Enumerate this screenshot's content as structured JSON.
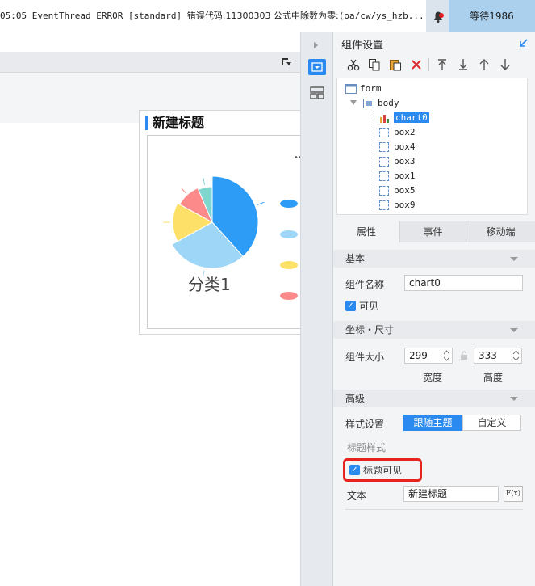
{
  "status": {
    "message_prefix": "05:05 EventThread ERROR [standard] ",
    "message_cjk": "错误代码:11300303 公式中除数为零:",
    "message_suffix": "(oa/cw/ys_hzb...",
    "user": "等待1986"
  },
  "chart_panel": {
    "title": "新建标题",
    "more_label": "•••",
    "category_label": "分类1",
    "legend_text": "..."
  },
  "chart_data": {
    "type": "pie",
    "title": "新建标题",
    "xlabel": "分类1",
    "slices": [
      {
        "value": 36,
        "color": "#2c9cf6"
      },
      {
        "value": 27,
        "color": "#9dd6f7"
      },
      {
        "value": 15,
        "color": "#fce067"
      },
      {
        "value": 10,
        "color": "#fc8a8a"
      },
      {
        "value": 6,
        "color": "#7fd6cf"
      }
    ],
    "legend_colors": [
      "#2c9cf6",
      "#9dd6f7",
      "#fce067",
      "#fc8a8a"
    ]
  },
  "right_panel": {
    "header": "组件设置",
    "tree": {
      "form": "form",
      "body": "body",
      "items": [
        "chart0",
        "box2",
        "box4",
        "box3",
        "box1",
        "box5",
        "box9"
      ]
    },
    "tabs": [
      "属性",
      "事件",
      "移动端"
    ],
    "sections": {
      "basic": "基本",
      "coords": "坐标・尺寸",
      "advanced": "高级"
    },
    "fields": {
      "component_name_label": "组件名称",
      "component_name_value": "chart0",
      "visible_label": "可见",
      "size_label": "组件大小",
      "width_value": "299",
      "height_value": "333",
      "width_caption": "宽度",
      "height_caption": "高度",
      "style_label": "样式设置",
      "style_follow": "跟随主题",
      "style_custom": "自定义",
      "title_style_label": "标题样式",
      "title_visible_label": "标题可见",
      "text_label": "文本",
      "text_value": "新建标题",
      "formula_button": "F(x)"
    }
  },
  "colors": {
    "accent": "#2b8af0",
    "highlight_box": "#e8231f",
    "user_bg": "#aad0ee"
  }
}
